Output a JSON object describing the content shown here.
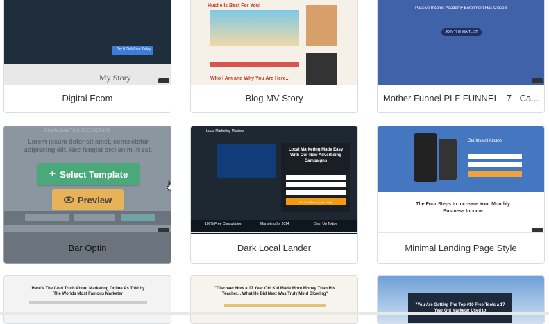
{
  "cards": [
    {
      "title": "Digital Ecom",
      "thumb_text": "My Story",
      "cta": "Try It Risk Free Today"
    },
    {
      "title": "Blog MV Story",
      "thumb_text": "Hustle Is Best For You!",
      "thumb_text2": "Who I Am and Why You Are Here..."
    },
    {
      "title": "Mother Funnel PLF FUNNEL - 7 - Ca...",
      "thumb_text": "Passive Income Academy Enrollment Has Closed",
      "cta": "JOIN THE WAITLIST"
    },
    {
      "title": "Bar Optin",
      "thumb_text": "DOWNLOAD THIS FREE REPORT:",
      "thumb_text2": "Lorem ipsum dolor sit amet, consectetur adipiscing elit. Nec feugiat orci enim in est."
    },
    {
      "title": "Dark Local Lander",
      "thumb_text": "Local Marketing Masters",
      "thumb_text2": "Local Marketing Made Easy With Our New Advertising Campaigns",
      "cta": "Get Your Free Quote Today",
      "strip1": "100% Free Consultation",
      "strip2": "Marketing for 2014",
      "strip3": "Sign Up Today"
    },
    {
      "title": "Minimal Landing Page Style",
      "thumb_text": "Get Instant Access",
      "thumb_text2": "The Four Steps to Increase Your Monthly Business Income"
    },
    {
      "thumb_text": "Here's The Cold Truth About Marketing Online As Told by The Worlds Most Famous Marketer"
    },
    {
      "thumb_text": "\"Discover How a 17 Year Old Kid Made More Money Than His Teacher... What He Did Next Was Truly Mind Blowing\""
    },
    {
      "thumb_text": "\"You Are Getting The Top #10 Free Tools a 17 Year Old Marketer Used to"
    }
  ],
  "hover_actions": {
    "select_label": "Select Template",
    "select_icon": "plus-icon",
    "preview_label": "Preview",
    "preview_icon": "eye-icon"
  },
  "colors": {
    "select": "#4aa97a",
    "preview": "#e8b258"
  }
}
